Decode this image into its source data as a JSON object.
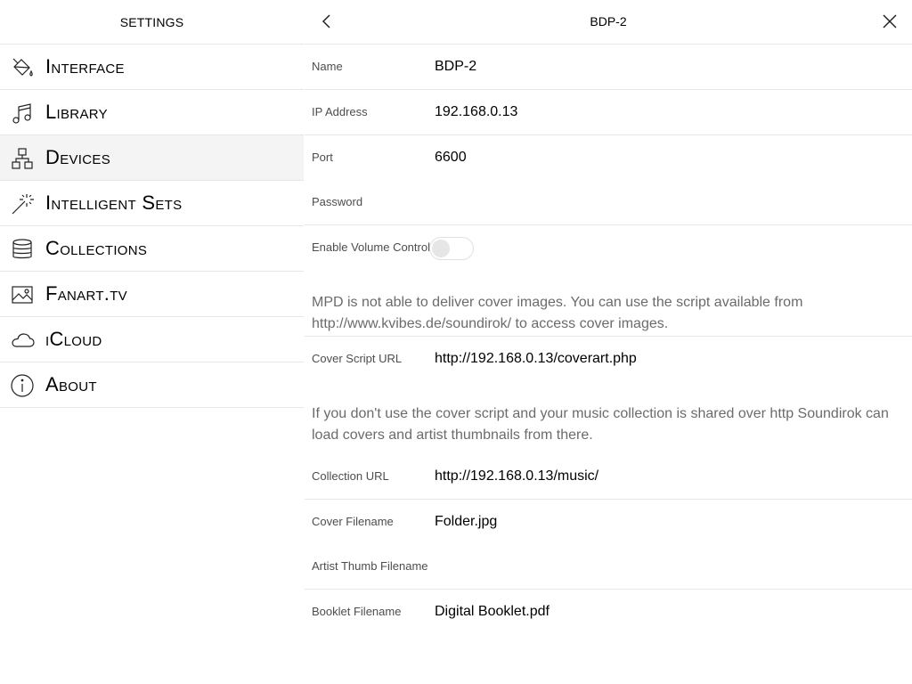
{
  "sidebar": {
    "title": "SETTINGS",
    "items": [
      {
        "label": "Interface",
        "icon": "paint-bucket-icon"
      },
      {
        "label": "Library",
        "icon": "music-note-icon"
      },
      {
        "label": "Devices",
        "icon": "devices-network-icon",
        "selected": true
      },
      {
        "label": "Intelligent Sets",
        "icon": "magic-wand-icon"
      },
      {
        "label": "Collections",
        "icon": "database-icon"
      },
      {
        "label": "Fanart.tv",
        "icon": "image-icon"
      },
      {
        "label": "iCloud",
        "icon": "cloud-icon"
      },
      {
        "label": "About",
        "icon": "info-icon"
      }
    ]
  },
  "header": {
    "title": "BDP-2",
    "back_icon": "chevron-left-icon",
    "close_icon": "close-icon"
  },
  "form": {
    "name": {
      "label": "Name",
      "value": "BDP-2"
    },
    "ip": {
      "label": "IP Address",
      "value": "192.168.0.13"
    },
    "port": {
      "label": "Port",
      "value": "6600"
    },
    "password": {
      "label": "Password",
      "value": ""
    },
    "volume": {
      "label": "Enable Volume Control",
      "enabled": false
    },
    "cover_note": "MPD is not able to deliver cover images. You can use the script available from http://www.kvibes.de/soundirok/ to access cover images.",
    "cover_script": {
      "label": "Cover Script URL",
      "value": "http://192.168.0.13/coverart.php"
    },
    "collection_note": "If you don't use the cover script and your music collection is shared over http Soundirok can load covers and artist thumbnails from there.",
    "collection_url": {
      "label": "Collection URL",
      "value": "http://192.168.0.13/music/"
    },
    "cover_filename": {
      "label": "Cover Filename",
      "value": "Folder.jpg"
    },
    "artist_thumb": {
      "label": "Artist Thumb Filename",
      "value": ""
    },
    "booklet": {
      "label": "Booklet Filename",
      "value": "Digital Booklet.pdf"
    }
  },
  "colors": {
    "selected_bg": "#f4f4f4",
    "divider": "#e6e6e6",
    "note_text": "#6b6b6b"
  }
}
